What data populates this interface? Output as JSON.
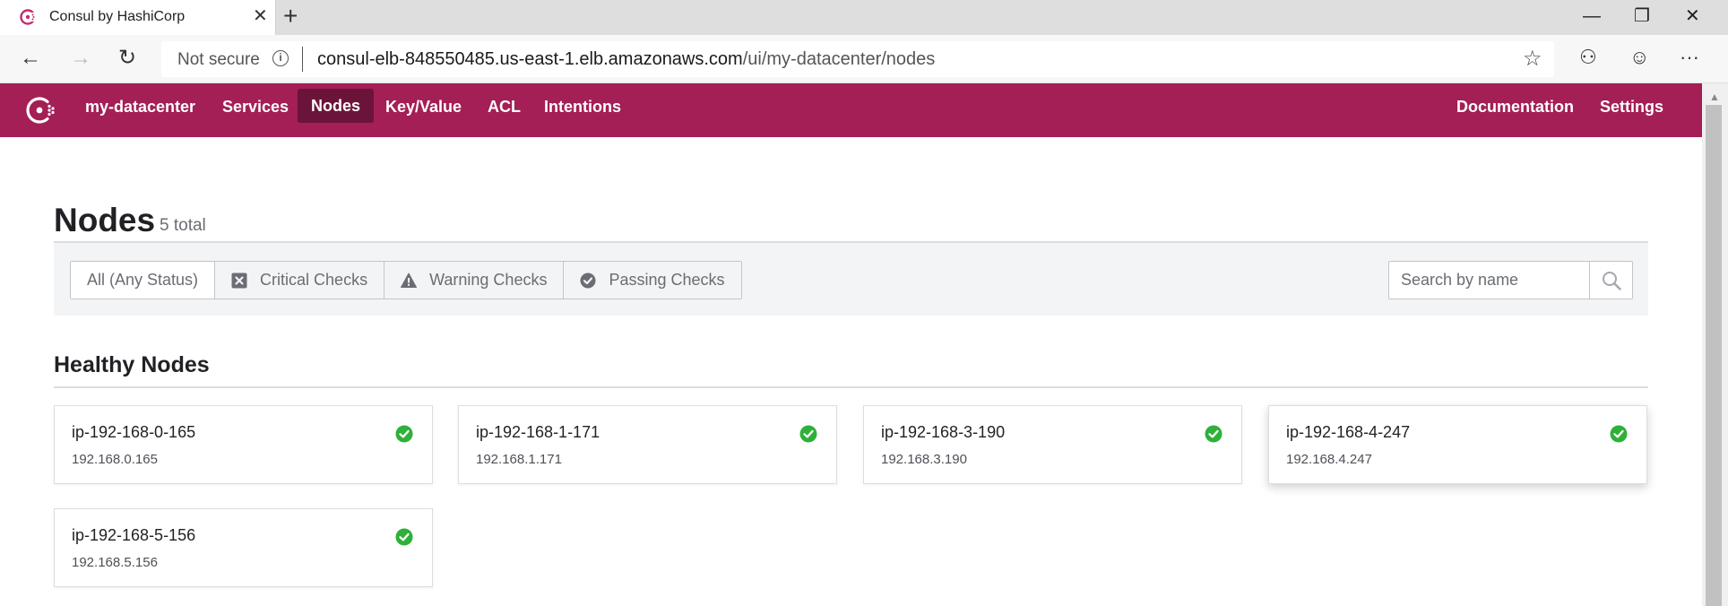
{
  "browser": {
    "tab_title": "Consul by HashiCorp",
    "tab_close": "✕",
    "new_tab": "+",
    "window_controls": {
      "minimize": "—",
      "restore": "❐",
      "close": "✕"
    },
    "nav": {
      "back": "←",
      "forward": "→",
      "reload": "↻"
    },
    "security_label": "Not secure",
    "url_host": "consul-elb-848550485.us-east-1.elb.amazonaws.com",
    "url_path": "/ui/my-datacenter/nodes",
    "toolbar": {
      "favorite": "☆",
      "profile": "⚇",
      "emoji": "☺",
      "more": "···"
    }
  },
  "consul_nav": {
    "datacenter": "my-datacenter",
    "items": [
      {
        "label": "Services",
        "active": false
      },
      {
        "label": "Nodes",
        "active": true
      },
      {
        "label": "Key/Value",
        "active": false
      },
      {
        "label": "ACL",
        "active": false
      },
      {
        "label": "Intentions",
        "active": false
      }
    ],
    "right_items": [
      {
        "label": "Documentation"
      },
      {
        "label": "Settings"
      }
    ],
    "brand_color": "#a31f56",
    "active_color": "#6b1439"
  },
  "page": {
    "title": "Nodes",
    "count": "5 total"
  },
  "filters": {
    "options": [
      {
        "label": "All (Any Status)",
        "icon": "none",
        "selected": true
      },
      {
        "label": "Critical Checks",
        "icon": "critical-icon",
        "selected": false
      },
      {
        "label": "Warning Checks",
        "icon": "warning-icon",
        "selected": false
      },
      {
        "label": "Passing Checks",
        "icon": "passing-icon",
        "selected": false
      }
    ],
    "search_placeholder": "Search by name",
    "search_value": ""
  },
  "healthy_section": {
    "title": "Healthy Nodes",
    "status_color": "#2eb039",
    "nodes": [
      {
        "name": "ip-192-168-0-165",
        "ip": "192.168.0.165",
        "status": "passing"
      },
      {
        "name": "ip-192-168-1-171",
        "ip": "192.168.1.171",
        "status": "passing"
      },
      {
        "name": "ip-192-168-3-190",
        "ip": "192.168.3.190",
        "status": "passing"
      },
      {
        "name": "ip-192-168-4-247",
        "ip": "192.168.4.247",
        "status": "passing"
      },
      {
        "name": "ip-192-168-5-156",
        "ip": "192.168.5.156",
        "status": "passing"
      }
    ]
  }
}
